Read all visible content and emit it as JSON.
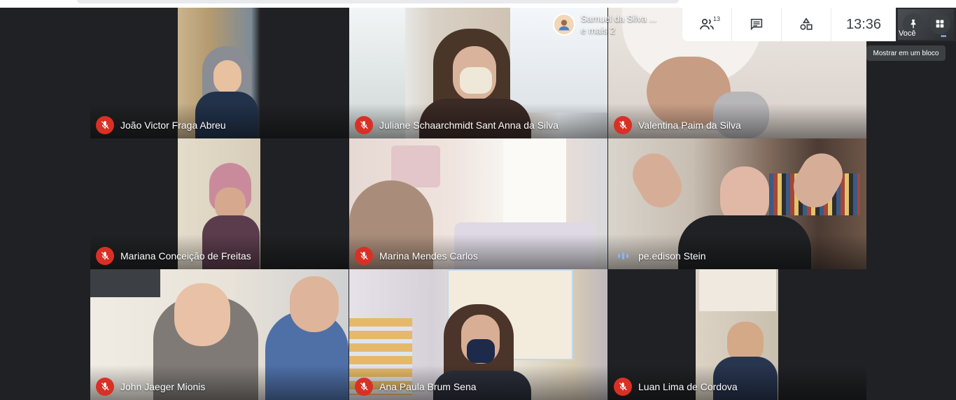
{
  "presenter_card": {
    "line1": "Samuel da Silva ...",
    "line2": "e mais 2",
    "avatar_icon": "person-avatar"
  },
  "controls": {
    "participants_count": "13",
    "participants_icon": "people-icon",
    "chat_icon": "chat-icon",
    "activities_icon": "shapes-icon",
    "time": "13:36"
  },
  "self_view": {
    "label": "Você",
    "pin_icon": "pin-icon",
    "layout_icon": "grid-layout-icon"
  },
  "tooltip": {
    "text": "Mostrar em um bloco"
  },
  "tiles": [
    {
      "name": "João Victor Fraga Abreu",
      "status": "muted"
    },
    {
      "name": "Juliane Schaarchmidt Sant Anna da Silva",
      "status": "muted"
    },
    {
      "name": "Valentina Paim da Silva",
      "status": "muted"
    },
    {
      "name": "Mariana Conceição de Freitas",
      "status": "muted"
    },
    {
      "name": "Marina Mendes Carlos",
      "status": "muted"
    },
    {
      "name": "pe.edison Stein",
      "status": "speaking"
    },
    {
      "name": "John Jaeger Mionis",
      "status": "muted"
    },
    {
      "name": "Ana Paula Brum Sena",
      "status": "muted"
    },
    {
      "name": "Luan Lima de Cordova",
      "status": "muted"
    }
  ],
  "colors": {
    "muted_badge": "#d93025",
    "speaking_indicator": "#8ab4f8",
    "background": "#202124"
  }
}
